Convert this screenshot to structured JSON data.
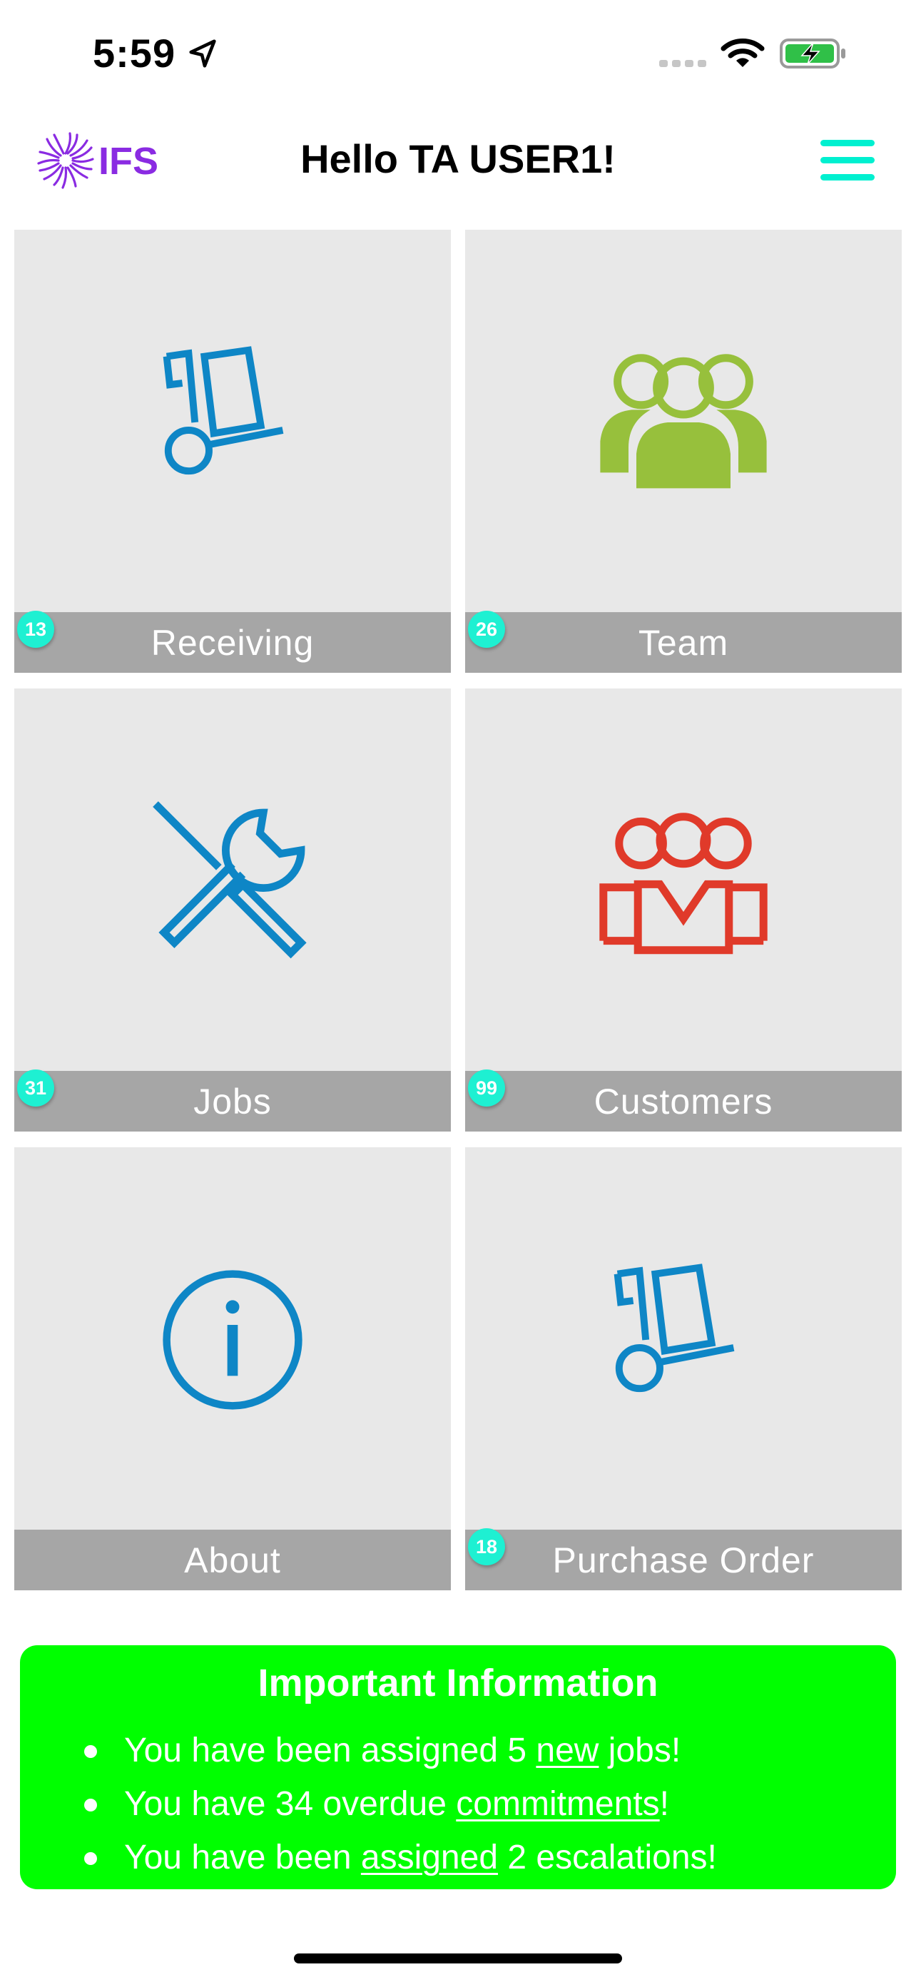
{
  "status_bar": {
    "time": "5:59"
  },
  "header": {
    "logo_text": "IFS",
    "title": "Hello TA USER1!"
  },
  "colors": {
    "accent": "#1ef0d2",
    "tile_bg": "#e8e8e8",
    "label_bar": "#a6a6a6",
    "icon_blue": "#0e86c6",
    "icon_green": "#97c03c",
    "icon_red": "#e03a2a",
    "info_bg": "#00ff00",
    "logo_purple": "#8a2be2"
  },
  "tiles": [
    {
      "label": "Receiving",
      "badge": "13",
      "icon": "hand-truck-icon"
    },
    {
      "label": "Team",
      "badge": "26",
      "icon": "team-icon"
    },
    {
      "label": "Jobs",
      "badge": "31",
      "icon": "tools-icon"
    },
    {
      "label": "Customers",
      "badge": "99",
      "icon": "customers-icon"
    },
    {
      "label": "About",
      "badge": "",
      "icon": "info-icon"
    },
    {
      "label": "Purchase Order",
      "badge": "18",
      "icon": "hand-truck-icon"
    }
  ],
  "info": {
    "title": "Important Information",
    "items": [
      {
        "pre": "You have been assigned 5 ",
        "link": "new",
        "post": " jobs!"
      },
      {
        "pre": "You have 34 overdue ",
        "link": "commitments",
        "post": "!"
      },
      {
        "pre": "You have been ",
        "link": "assigned",
        "post": " 2 escalations!"
      }
    ]
  }
}
